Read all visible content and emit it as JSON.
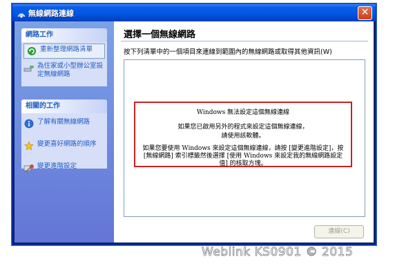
{
  "window": {
    "title": "無線網路連線",
    "close_symbol": "✕"
  },
  "sidebar": {
    "network_tasks": {
      "header": "網路工作",
      "items": [
        {
          "label": "重新整理網路清單",
          "icon": "refresh-icon"
        },
        {
          "label": "為住家或小型辦公室設定無線網路",
          "icon": "wireless-setup-icon"
        }
      ]
    },
    "related_tasks": {
      "header": "相關的工作",
      "items": [
        {
          "label": "了解有關無線網路",
          "icon": "info-icon"
        },
        {
          "label": "變更喜好網路的順序",
          "icon": "star-icon"
        },
        {
          "label": "變更進階設定",
          "icon": "settings-icon"
        }
      ]
    }
  },
  "main": {
    "heading": "選擇一個無線網路",
    "description": "按下列清單中的一個項目來連線到範圍內的無線網路或取得其他資訊(W)",
    "message": {
      "line1": "Windows 無法設定這個無線連線",
      "line2": "如果您已啟用另外的程式來設定這個無線連線，",
      "line3": "請使用該軟體。",
      "line4": "如果您要使用 Windows 來設定這個無線連線，請按 [變更進階設定]，按 [無線網路] 索引標籤然後選擇 [使用 Windows 來設定我的無線網路設定值] 的核取方塊。"
    },
    "connect_button": "連線(C)"
  },
  "watermark": "Weblink KS0901 © 2015",
  "colors": {
    "title_bar": "#0058e6",
    "sidebar": "#6f8fe0",
    "highlight_border": "#cc1f1f"
  }
}
